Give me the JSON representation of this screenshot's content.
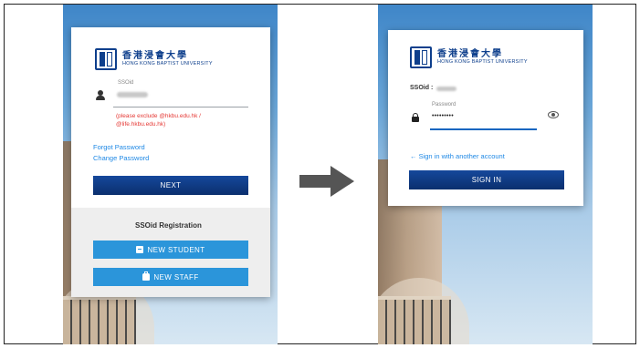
{
  "left_screen": {
    "logo": {
      "chinese": "香港浸會大學",
      "english": "HONG KONG BAPTIST UNIVERSITY"
    },
    "ssoid_label": "SSOid",
    "hint_text": "(please exclude @hkbu.edu.hk / @life.hkbu.edu.hk)",
    "forgot_password": "Forgot Password",
    "change_password": "Change Password",
    "next_button": "NEXT",
    "registration_title": "SSOid Registration",
    "new_student_button": "NEW STUDENT",
    "new_staff_button": "NEW STAFF"
  },
  "right_screen": {
    "logo": {
      "chinese": "香港浸會大學",
      "english": "HONG KONG BAPTIST UNIVERSITY"
    },
    "ssoid_label": "SSOid :",
    "password_label": "Password",
    "password_mask": "•••••••••",
    "sign_in_other": "← Sign in with another account",
    "sign_in_button": "SIGN IN"
  },
  "icons": [
    "user-icon",
    "arrow-right-icon",
    "lock-icon",
    "eye-icon",
    "student-id-icon",
    "staff-briefcase-icon",
    "university-logo-icon"
  ],
  "colors": {
    "navy": "#0e3f8c",
    "sky_button": "#2b95da",
    "link": "#1e88e5",
    "hint": "#e53935"
  }
}
